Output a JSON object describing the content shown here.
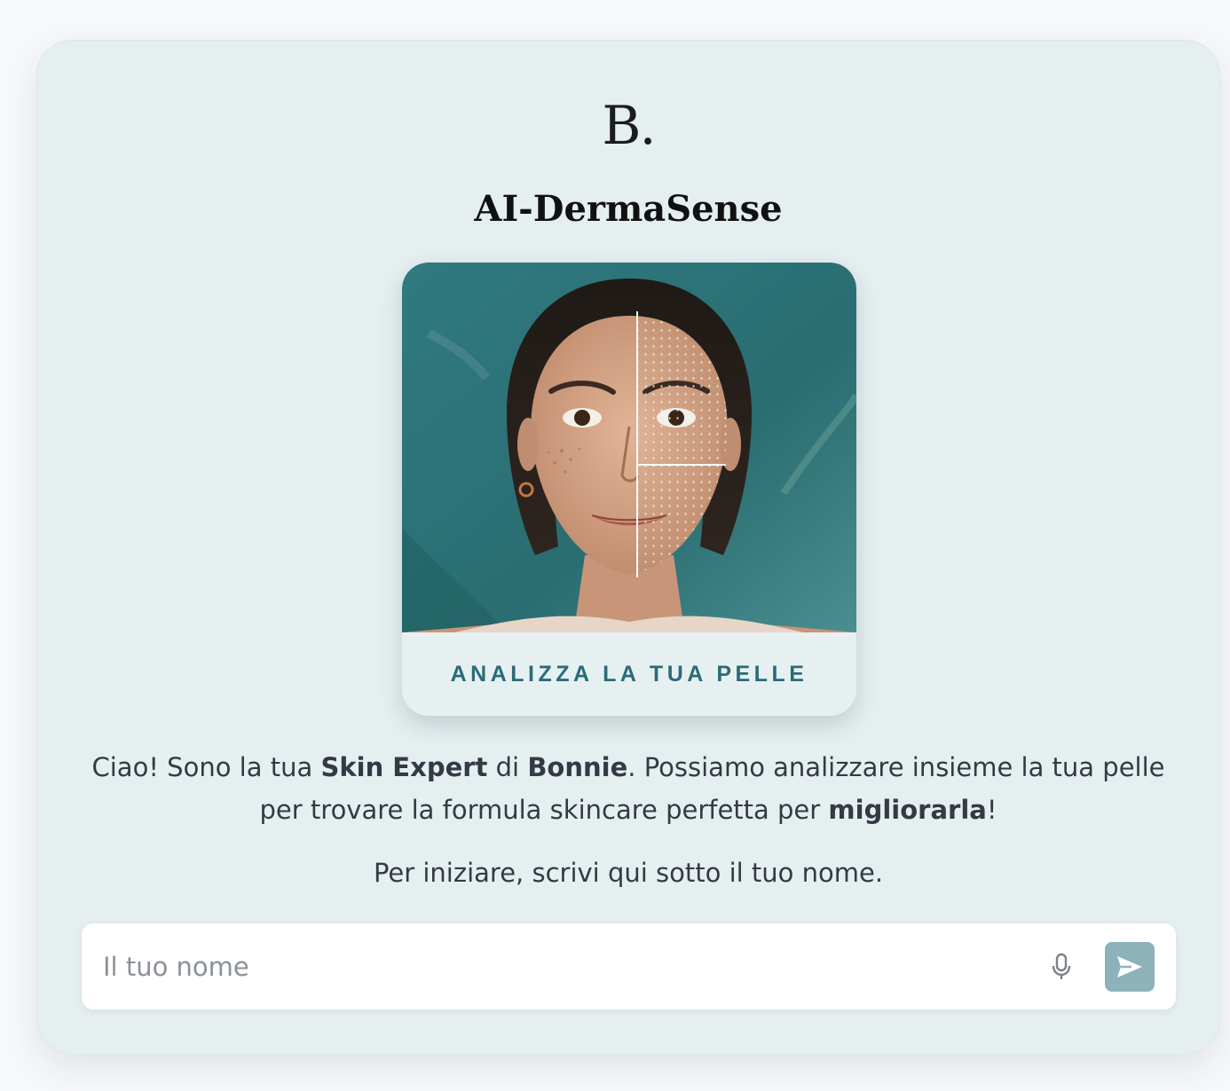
{
  "brand": {
    "logo_text": "B.",
    "title": "AI-DermaSense"
  },
  "hero": {
    "image_description": "portrait",
    "cta_label": "ANALIZZA LA TUA PELLE"
  },
  "intro": {
    "part1": "Ciao! Sono la tua ",
    "expert": "Skin Expert",
    "part2": " di ",
    "brand_name": "Bonnie",
    "part3": ". Possiamo analizzare insieme la tua pelle per trovare la formula skincare perfetta per ",
    "improve": "migliorarla",
    "part4": "!"
  },
  "prompt": "Per iniziare, scrivi qui sotto il tuo nome.",
  "input": {
    "placeholder": "Il tuo nome",
    "value": "",
    "mic_icon": "microphone-icon",
    "send_icon": "send-icon"
  },
  "colors": {
    "card_bg": "#e6eff0",
    "accent": "#2a6b78",
    "send_button": "#8db2ba",
    "text": "#333a44"
  }
}
